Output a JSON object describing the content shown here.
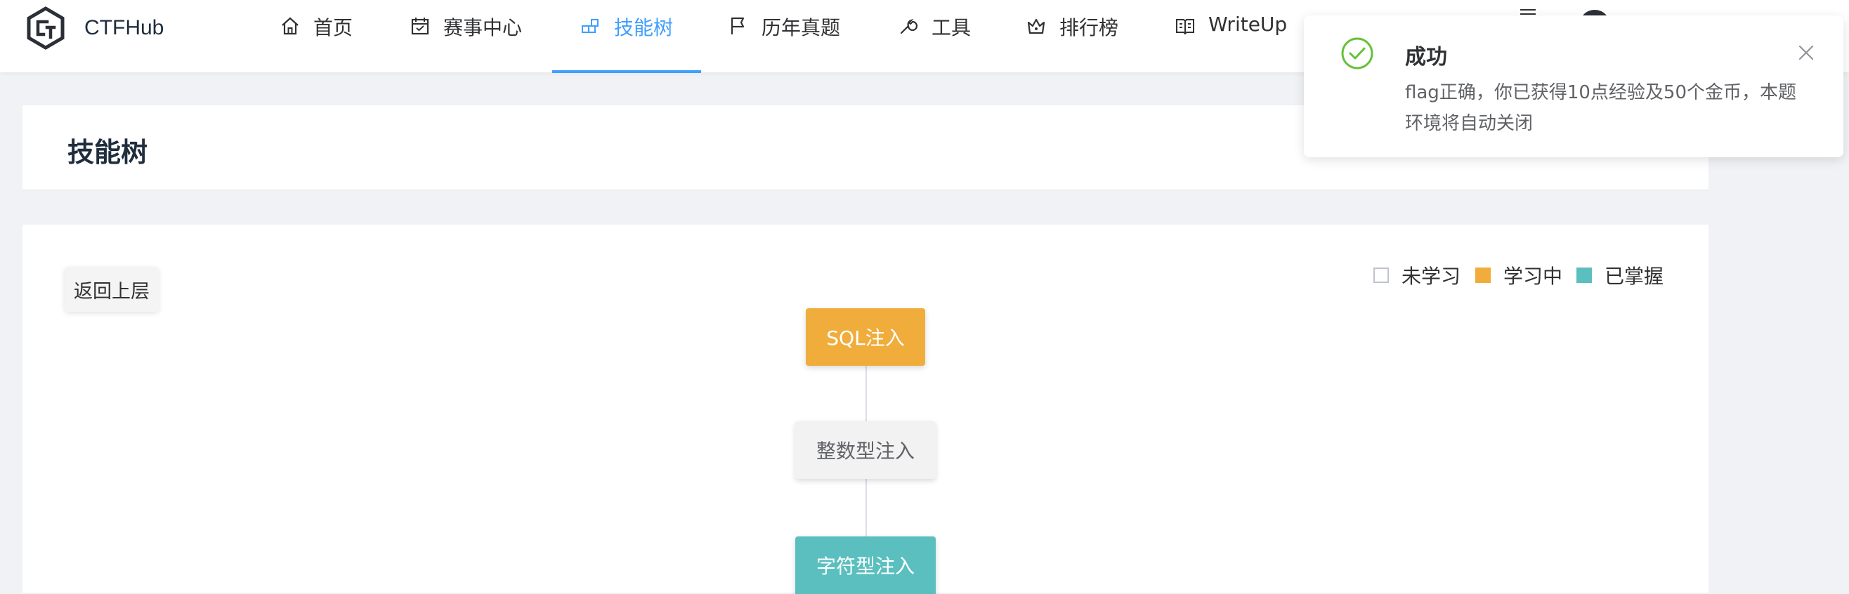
{
  "brand": {
    "name": "CTFHub"
  },
  "nav": [
    {
      "label": "首页",
      "icon": "home-icon"
    },
    {
      "label": "赛事中心",
      "icon": "calendar-icon"
    },
    {
      "label": "技能树",
      "icon": "skill-tree-icon",
      "active": true
    },
    {
      "label": "历年真题",
      "icon": "flag-icon"
    },
    {
      "label": "工具",
      "icon": "wrench-icon"
    },
    {
      "label": "排行榜",
      "icon": "trophy-icon"
    },
    {
      "label": "WriteUp",
      "icon": "book-icon"
    }
  ],
  "page": {
    "title": "技能树",
    "back_label": "返回上层"
  },
  "legend": [
    {
      "label": "未学习",
      "color": "#ffffff",
      "border": "#c0c4cc"
    },
    {
      "label": "学习中",
      "color": "#f0ad3c"
    },
    {
      "label": "已掌握",
      "color": "#5bbfbf"
    }
  ],
  "tree": {
    "root": "SQL注入",
    "children": [
      "整数型注入",
      "字符型注入"
    ]
  },
  "notification": {
    "title": "成功",
    "message": "flag正确，你已获得10点经验及50个金币，本题环境将自动关闭",
    "status_color": "#67c23a"
  },
  "colors": {
    "accent": "#409eff",
    "learning": "#f0ad3c",
    "mastered": "#5bbfbf"
  }
}
